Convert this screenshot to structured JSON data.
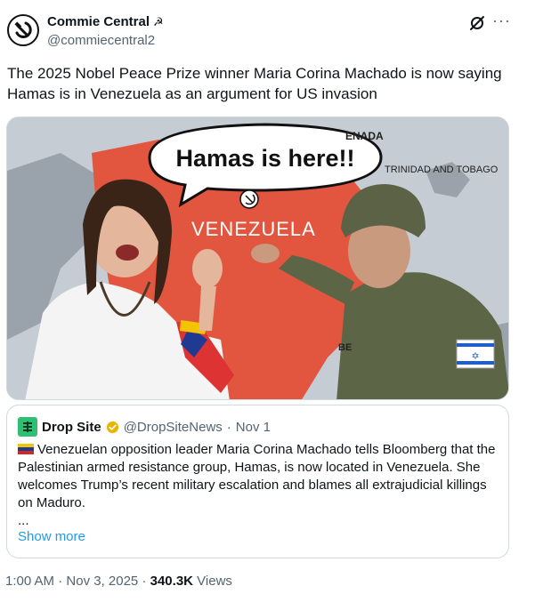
{
  "author": {
    "display_name": "Commie Central",
    "name_emoji": "☭",
    "handle": "@commiecentral2",
    "avatar_icon": "hammer-sickle-icon"
  },
  "header_icons": [
    "grok-icon",
    "more-icon"
  ],
  "tweet": {
    "text": "The 2025 Nobel Peace Prize winner Maria Corina Machado is now saying Hamas is in Venezuela as an argument for US invasion"
  },
  "media": {
    "speech_bubble": "Hamas is here!!",
    "map_label_country": "VENEZUELA",
    "map_label_trinidad": "TRINIDAD AND TOBAGO",
    "map_label_grenada": "ENADA",
    "map_label_partial": "BE",
    "colors": {
      "sea": "#c5ccd3",
      "land": "#9aa3ab",
      "venezuela": "#e2553f",
      "accent_blue": "#1d9bf0"
    }
  },
  "quote": {
    "name": "Drop Site",
    "handle": "@DropSiteNews",
    "separator": "·",
    "date": "Nov 1",
    "text": "Venezuelan opposition leader Maria Corina Machado tells Bloomberg that the Palestinian armed resistance group, Hamas, is now located in Venezuela. She welcomes Trump’s recent military escalation and blames all extrajudicial killings on Maduro.",
    "ellipsis": "...",
    "show_more": "Show more"
  },
  "meta": {
    "time": "1:00 AM",
    "sep1": "·",
    "date": "Nov 3, 2025",
    "sep2": "·",
    "views_count": "340.3K",
    "views_label": "Views"
  }
}
